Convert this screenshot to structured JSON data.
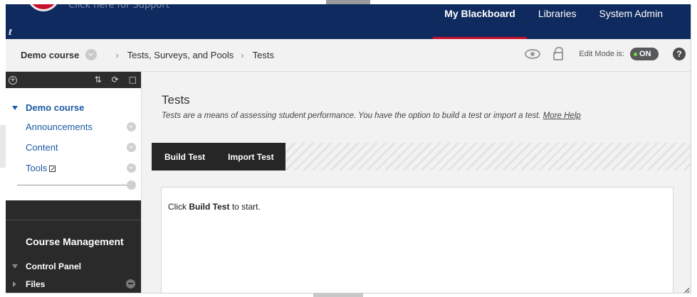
{
  "header": {
    "logo_text": "Click here for Support",
    "nav": [
      "My Blackboard",
      "Libraries",
      "System Admin"
    ]
  },
  "breadcrumb": {
    "course": "Demo course",
    "items": [
      "Tests, Surveys, and Pools",
      "Tests"
    ],
    "edit_mode_label": "Edit Mode is:",
    "edit_mode_value": "ON",
    "help": "?"
  },
  "sidebar": {
    "course_title": "Demo course",
    "items": [
      "Announcements",
      "Content",
      "Tools"
    ],
    "course_management": "Course Management",
    "control_panel": "Control Panel",
    "files": "Files"
  },
  "main": {
    "title": "Tests",
    "description": "Tests are a means of assessing student performance. You have the option to build a test or import a test.",
    "more_help": "More Help",
    "actions": [
      "Build Test",
      "Import Test"
    ],
    "msg_before": "Click",
    "msg_bold": "Build Test",
    "msg_after": "to start."
  },
  "colors": {
    "header_bg": "#0f2a5e",
    "accent_red": "#c8102e",
    "link_blue": "#1b5aa3",
    "toggle_green": "#6fdc3b"
  }
}
